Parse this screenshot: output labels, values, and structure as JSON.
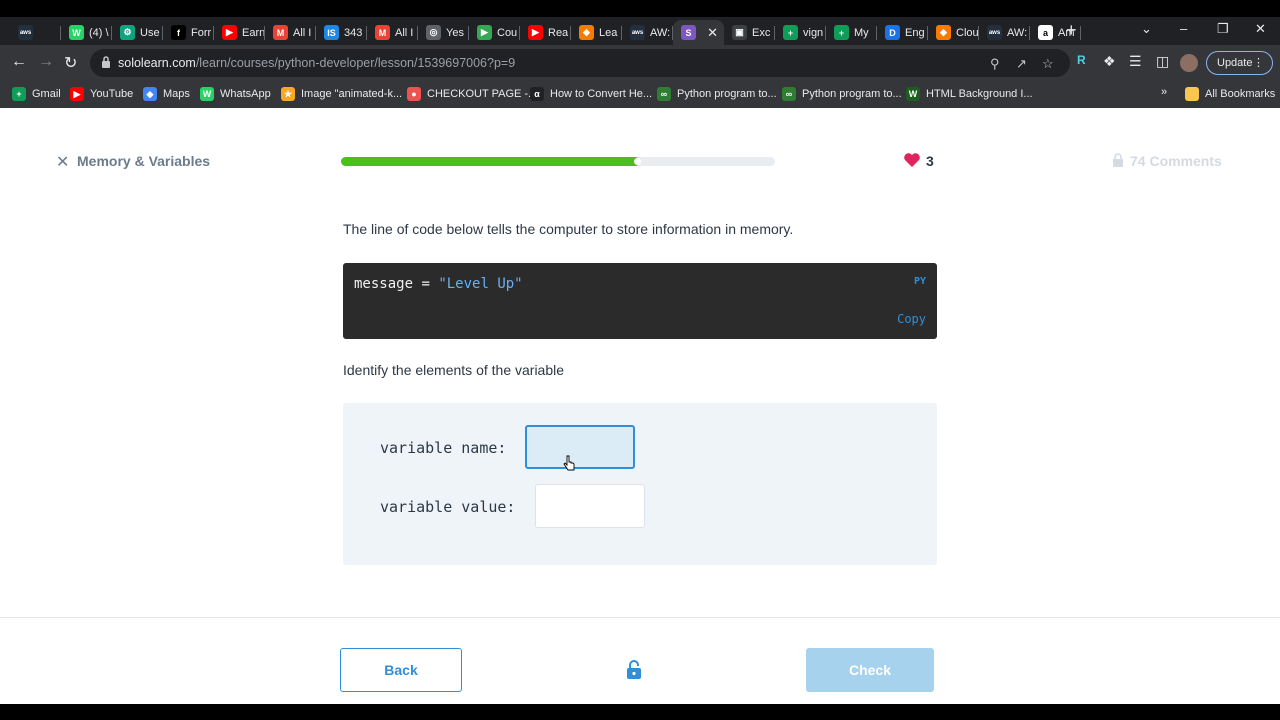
{
  "browser": {
    "tabs": [
      {
        "label": "",
        "icon": "aws-icon",
        "color": "#232f3e",
        "glyph": "aws"
      },
      {
        "label": "(4) \\",
        "icon": "whatsapp-icon",
        "color": "#25d366",
        "glyph": "W"
      },
      {
        "label": "Use",
        "icon": "chatgpt-icon",
        "color": "#10a37f",
        "glyph": "⚙"
      },
      {
        "label": "Forr",
        "icon": "site-icon",
        "color": "#000000",
        "glyph": "f"
      },
      {
        "label": "Earn",
        "icon": "youtube-icon",
        "color": "#ff0000",
        "glyph": "▶"
      },
      {
        "label": "All I",
        "icon": "gmail-icon",
        "color": "#ea4335",
        "glyph": "M"
      },
      {
        "label": "343",
        "icon": "is-icon",
        "color": "#1e88e5",
        "glyph": "IS"
      },
      {
        "label": "All I",
        "icon": "gmail-icon",
        "color": "#ea4335",
        "glyph": "M"
      },
      {
        "label": "Yes",
        "icon": "globe-icon",
        "color": "#5f6368",
        "glyph": "◎"
      },
      {
        "label": "Cou",
        "icon": "play-store-icon",
        "color": "#34a853",
        "glyph": "▶"
      },
      {
        "label": "Rea",
        "icon": "youtube-icon",
        "color": "#ff0000",
        "glyph": "▶"
      },
      {
        "label": "Lea",
        "icon": "box-icon",
        "color": "#f57c00",
        "glyph": "◆"
      },
      {
        "label": "AW:",
        "icon": "aws-icon",
        "color": "#232f3e",
        "glyph": "aws"
      },
      {
        "label": "",
        "icon": "sololearn-icon",
        "color": "#7e57c2",
        "glyph": "S",
        "active": true
      },
      {
        "label": "Exc",
        "icon": "site-icon",
        "color": "#3c4043",
        "glyph": "▣"
      },
      {
        "label": "vign",
        "icon": "sheets-icon",
        "color": "#0f9d58",
        "glyph": "+"
      },
      {
        "label": "My",
        "icon": "sheets-icon",
        "color": "#0f9d58",
        "glyph": "+"
      },
      {
        "label": "Eng",
        "icon": "d-icon",
        "color": "#1a73e8",
        "glyph": "D"
      },
      {
        "label": "Clou",
        "icon": "box-icon",
        "color": "#f57c00",
        "glyph": "◆"
      },
      {
        "label": "AW:",
        "icon": "aws-icon",
        "color": "#232f3e",
        "glyph": "aws"
      },
      {
        "label": "Am",
        "icon": "amazon-icon",
        "color": "#ffffff",
        "glyph": "a"
      }
    ],
    "url_host": "sololearn.com",
    "url_path": "/learn/courses/python-developer/lesson/1539697006?p=9",
    "update_label": "Update",
    "bookmarks": [
      {
        "label": "Gmail",
        "color": "#0f9d58",
        "glyph": "+"
      },
      {
        "label": "YouTube",
        "color": "#ff0000",
        "glyph": "▶"
      },
      {
        "label": "Maps",
        "color": "#4285f4",
        "glyph": "◆"
      },
      {
        "label": "WhatsApp",
        "color": "#25d366",
        "glyph": "W"
      },
      {
        "label": "Image \"animated-k...",
        "color": "#f9a825",
        "glyph": "★"
      },
      {
        "label": "CHECKOUT PAGE -...",
        "color": "#ef5350",
        "glyph": "●"
      },
      {
        "label": "How to Convert He...",
        "color": "#202124",
        "glyph": "α"
      },
      {
        "label": "Python program to...",
        "color": "#2e7d32",
        "glyph": "∞"
      },
      {
        "label": "Python program to...",
        "color": "#2e7d32",
        "glyph": "∞"
      },
      {
        "label": "HTML Background I...",
        "color": "#1b5e20",
        "glyph": "W"
      }
    ],
    "more_bookmarks": "»",
    "all_bookmarks": "All Bookmarks"
  },
  "lesson": {
    "title": "Memory & Variables",
    "progress": 0.69,
    "lives": "3",
    "comments": "74 Comments",
    "intro": "The line of code below tells the computer to store information in memory.",
    "code": {
      "var": "message",
      "op": " = ",
      "value": "\"Level Up\"",
      "lang": "PY",
      "copy": "Copy"
    },
    "question": "Identify the elements of the variable",
    "fields": [
      {
        "label": "variable name:",
        "value": ""
      },
      {
        "label": "variable value:",
        "value": ""
      }
    ],
    "back_label": "Back",
    "check_label": "Check"
  },
  "colors": {
    "accent": "#2f8fd8",
    "progress": "#49c11a",
    "heart": "#e0245e",
    "check_disabled": "#a6d2ee"
  }
}
